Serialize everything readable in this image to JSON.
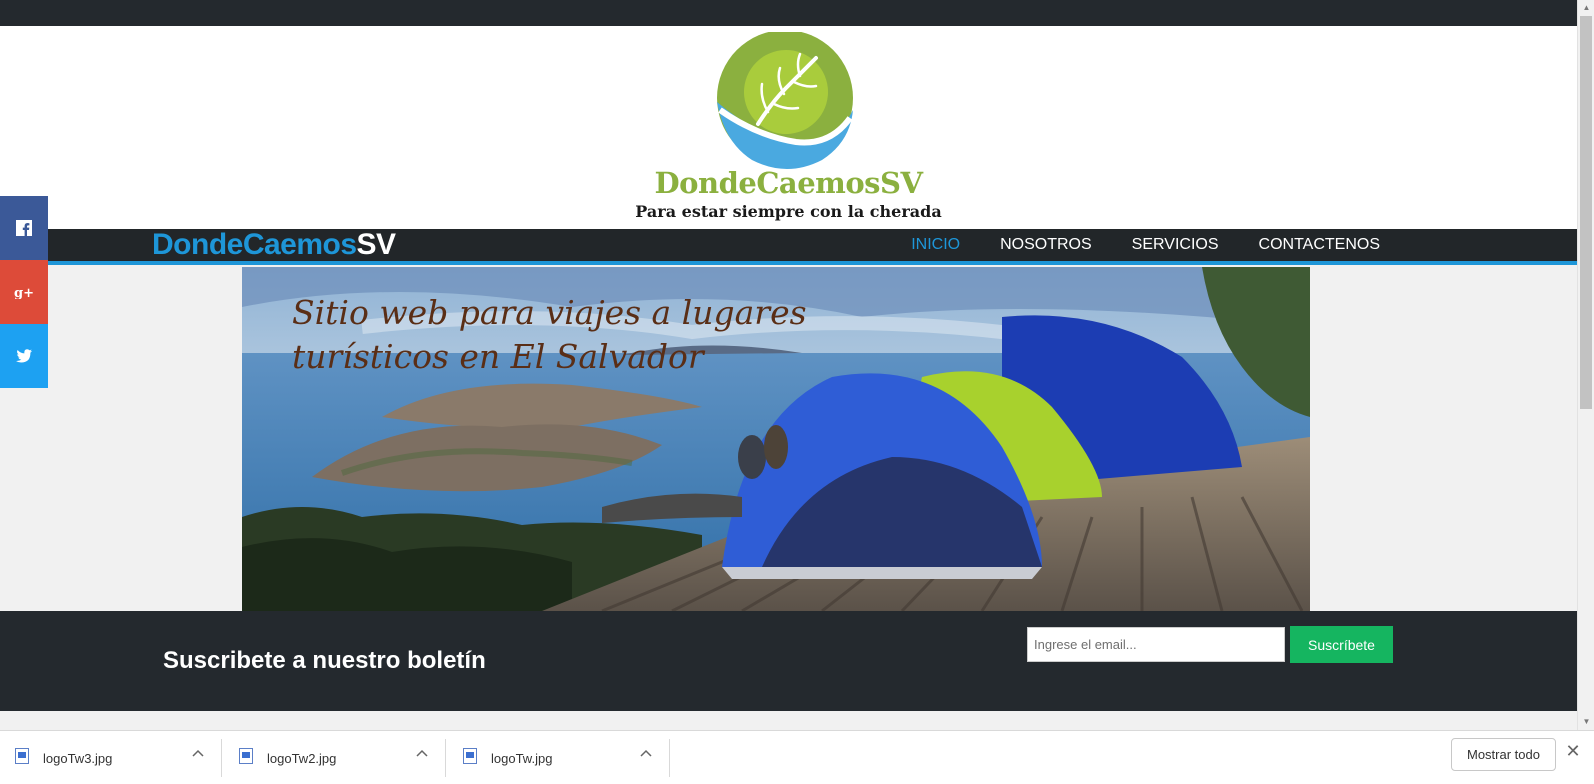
{
  "logo": {
    "title": "DondeCaemosSV",
    "subtitle": "Para estar siempre con la cherada"
  },
  "nav": {
    "brand_part1": "DondeCaemos",
    "brand_part2": "SV",
    "items": [
      {
        "label": "INICIO",
        "active": true
      },
      {
        "label": "NOSOTROS",
        "active": false
      },
      {
        "label": "SERVICIOS",
        "active": false
      },
      {
        "label": "CONTACTENOS",
        "active": false
      }
    ]
  },
  "social": [
    {
      "name": "facebook",
      "icon": "facebook-icon",
      "color": "#3b5998"
    },
    {
      "name": "google-plus",
      "icon": "google-plus-icon",
      "color": "#dd4b39"
    },
    {
      "name": "twitter",
      "icon": "twitter-icon",
      "color": "#1da1f2"
    }
  ],
  "hero": {
    "line1": "Sitio web para viajes a lugares",
    "line2": "turísticos en El Salvador"
  },
  "newsletter": {
    "title": "Suscribete a nuestro boletín",
    "email_placeholder": "Ingrese el email...",
    "button_label": "Suscríbete"
  },
  "downloads": {
    "files": [
      {
        "name": "logoTw3.jpg"
      },
      {
        "name": "logoTw2.jpg"
      },
      {
        "name": "logoTw.jpg"
      }
    ],
    "show_all_label": "Mostrar todo",
    "close_icon": "close-icon"
  },
  "colors": {
    "accent": "#1e96d8",
    "dark": "#24292e",
    "green_button": "#15b560",
    "logo_green": "#8bb03f",
    "logo_blue": "#4aa9e0"
  }
}
